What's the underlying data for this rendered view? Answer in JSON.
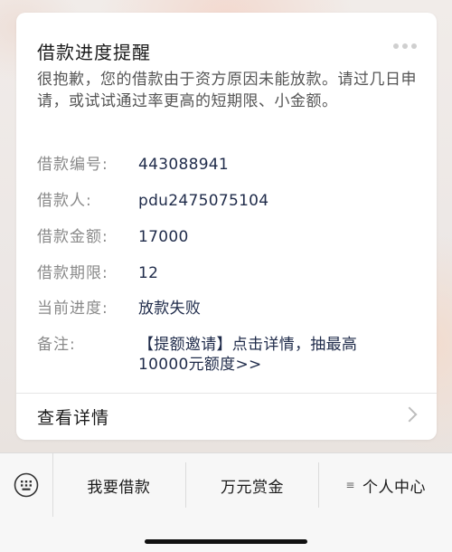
{
  "card": {
    "title": "借款进度提醒",
    "message": "很抱歉，您的借款由于资方原因未能放款。请过几日申请，或试试通过率更高的短期限、小金额。",
    "fields": [
      {
        "label": "借款编号:",
        "value": "443088941"
      },
      {
        "label": "借款人:",
        "value": "pdu2475075104"
      },
      {
        "label": "借款金额:",
        "value": "17000"
      },
      {
        "label": "借款期限:",
        "value": "12"
      },
      {
        "label": "当前进度:",
        "value": "放款失败"
      },
      {
        "label": "备注:",
        "value": "【提额邀请】点击详情，抽最高10000元额度>>"
      }
    ],
    "detail_link": "查看详情"
  },
  "menu": {
    "items": [
      {
        "label": "我要借款"
      },
      {
        "label": "万元赏金"
      },
      {
        "label": "个人中心",
        "icon": "submenu-icon"
      }
    ]
  },
  "icons": {
    "more": "more-icon",
    "keyboard": "keyboard-icon",
    "chevron": "chevron-right-icon"
  }
}
